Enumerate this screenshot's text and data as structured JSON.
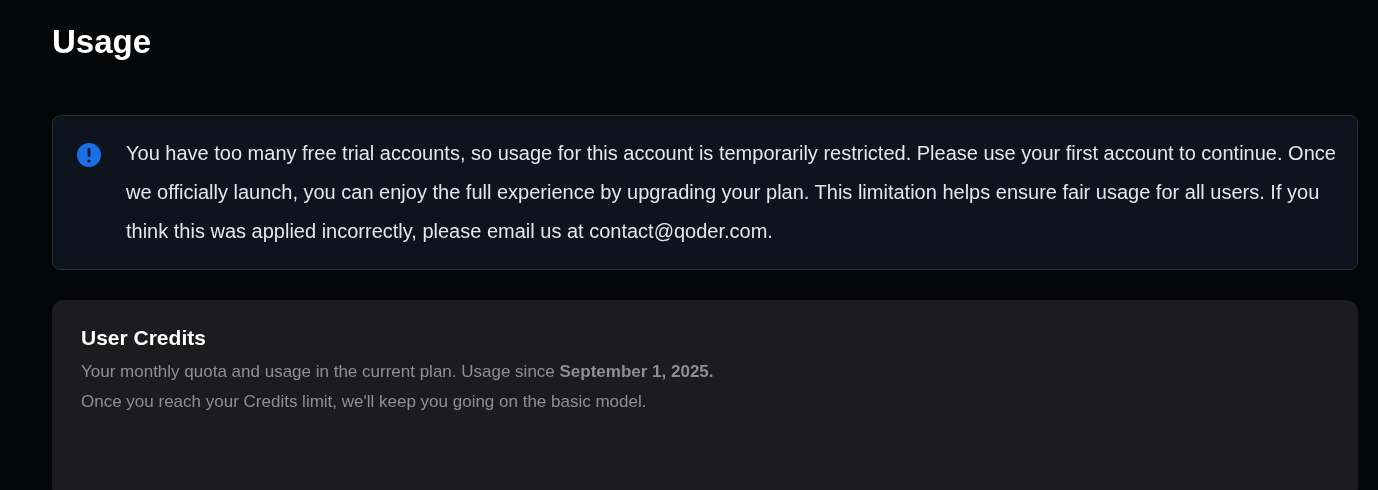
{
  "page_title": "Usage",
  "alert": {
    "message": "You have too many free trial accounts, so usage for this account is temporarily restricted. Please use your first account to continue. Once we officially launch, you can enjoy the full experience by upgrading your plan. This limitation helps ensure fair usage for all users. If you think this was applied incorrectly, please email us at contact@qoder.com."
  },
  "credits_card": {
    "title": "User Credits",
    "description_lines": [
      "Your monthly quota and usage in the current plan. Usage since **September 1, 2025.**",
      "Once you reach your Credits limit, we'll keep you going on the basic model."
    ]
  }
}
